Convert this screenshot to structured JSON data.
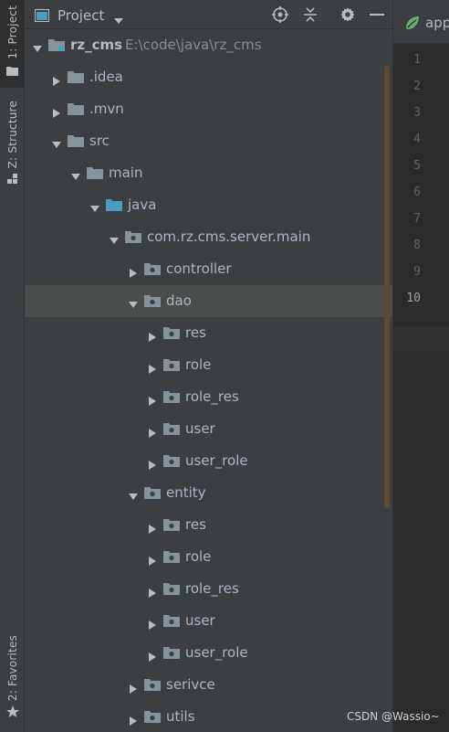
{
  "stripe": {
    "project_tab": "1: Project",
    "structure_tab": "Z: Structure",
    "favorites_tab": "2: Favorites"
  },
  "header": {
    "title": "Project"
  },
  "tree": [
    {
      "label": "rz_cms",
      "path": "E:\\code\\java\\rz_cms",
      "depth": 0,
      "expanded": true,
      "kind": "module",
      "bold": true
    },
    {
      "label": ".idea",
      "depth": 1,
      "expanded": false,
      "kind": "folder"
    },
    {
      "label": ".mvn",
      "depth": 1,
      "expanded": false,
      "kind": "folder"
    },
    {
      "label": "src",
      "depth": 1,
      "expanded": true,
      "kind": "folder"
    },
    {
      "label": "main",
      "depth": 2,
      "expanded": true,
      "kind": "folder"
    },
    {
      "label": "java",
      "depth": 3,
      "expanded": true,
      "kind": "source"
    },
    {
      "label": "com.rz.cms.server.main",
      "depth": 4,
      "expanded": true,
      "kind": "package"
    },
    {
      "label": "controller",
      "depth": 5,
      "expanded": false,
      "kind": "package"
    },
    {
      "label": "dao",
      "depth": 5,
      "expanded": true,
      "kind": "package",
      "selected": true
    },
    {
      "label": "res",
      "depth": 6,
      "expanded": false,
      "kind": "package"
    },
    {
      "label": "role",
      "depth": 6,
      "expanded": false,
      "kind": "package"
    },
    {
      "label": "role_res",
      "depth": 6,
      "expanded": false,
      "kind": "package"
    },
    {
      "label": "user",
      "depth": 6,
      "expanded": false,
      "kind": "package"
    },
    {
      "label": "user_role",
      "depth": 6,
      "expanded": false,
      "kind": "package"
    },
    {
      "label": "entity",
      "depth": 5,
      "expanded": true,
      "kind": "package"
    },
    {
      "label": "res",
      "depth": 6,
      "expanded": false,
      "kind": "package"
    },
    {
      "label": "role",
      "depth": 6,
      "expanded": false,
      "kind": "package"
    },
    {
      "label": "role_res",
      "depth": 6,
      "expanded": false,
      "kind": "package"
    },
    {
      "label": "user",
      "depth": 6,
      "expanded": false,
      "kind": "package"
    },
    {
      "label": "user_role",
      "depth": 6,
      "expanded": false,
      "kind": "package"
    },
    {
      "label": "serivce",
      "depth": 5,
      "expanded": false,
      "kind": "package"
    },
    {
      "label": "utils",
      "depth": 5,
      "expanded": false,
      "kind": "package"
    }
  ],
  "editor": {
    "tab_label": "app",
    "line_numbers": [
      "1",
      "2",
      "3",
      "4",
      "5",
      "6",
      "7",
      "8",
      "9",
      "10"
    ],
    "current_line": "10"
  },
  "watermark": "CSDN @Wassio~",
  "colors": {
    "panel_bg": "#3c3f41",
    "editor_bg": "#2b2b2b",
    "selection": "#4b4d4d",
    "folder": "#87939a",
    "source_folder": "#4a9cc0",
    "scrollbar": "#5e4b2f",
    "spring_leaf": "#6aab73"
  }
}
